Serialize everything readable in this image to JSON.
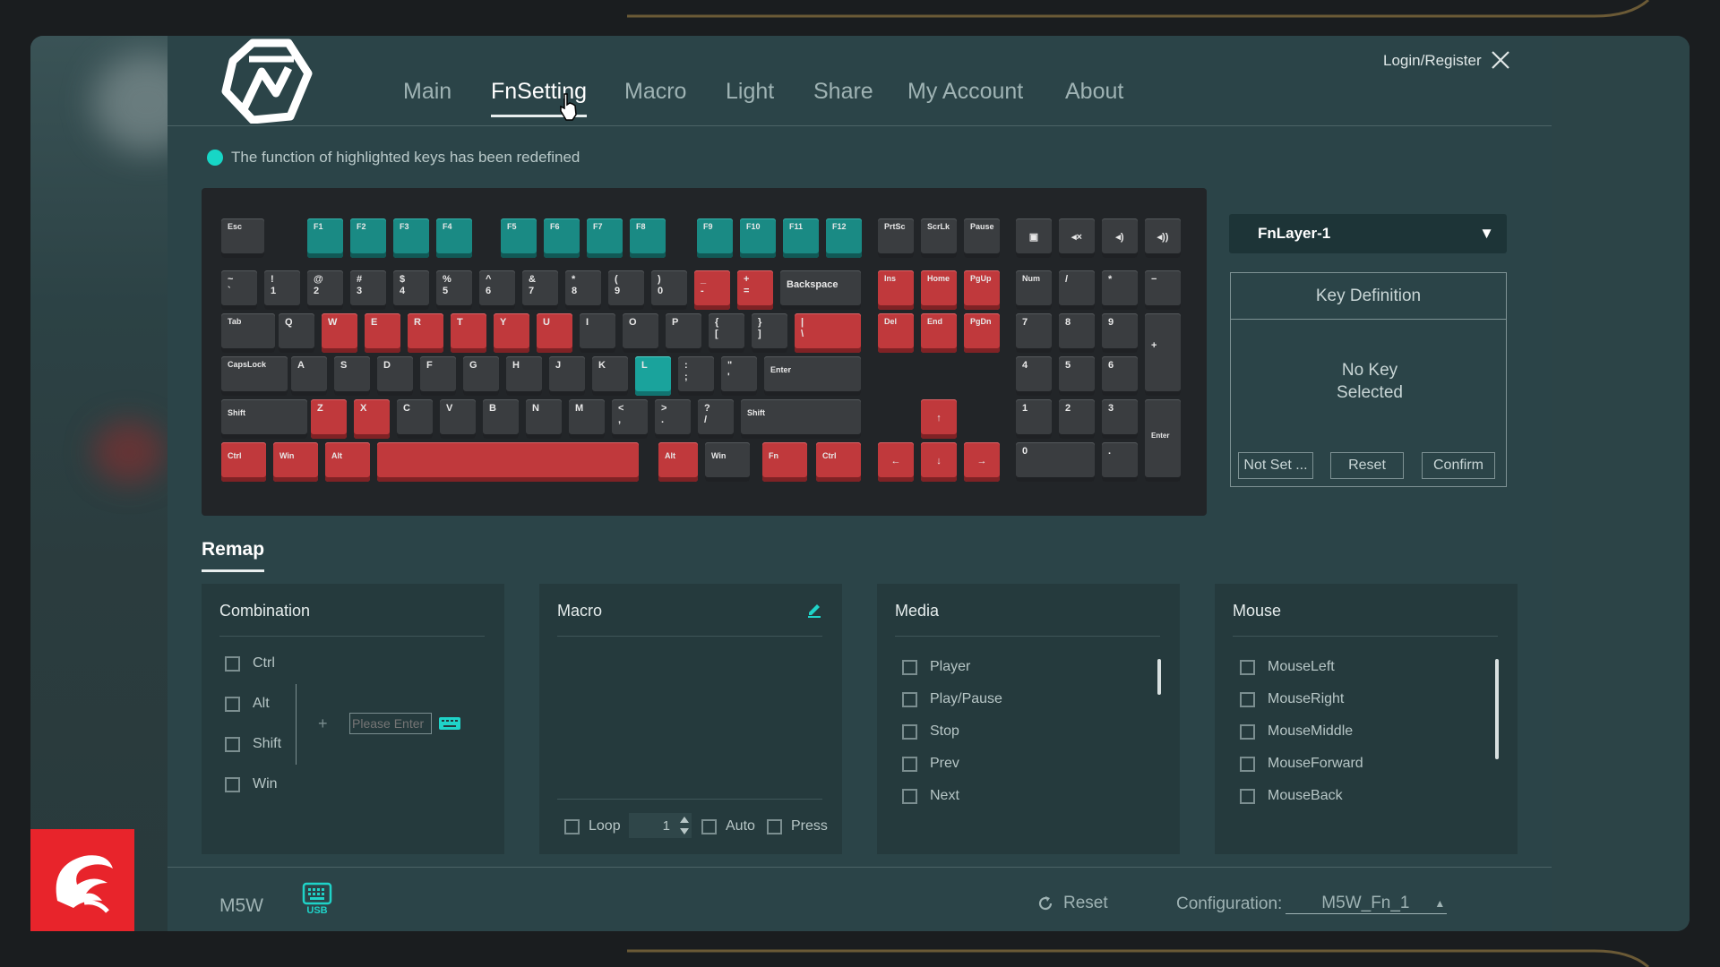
{
  "nav": {
    "items": [
      {
        "label": "Main"
      },
      {
        "label": "FnSetting"
      },
      {
        "label": "Macro"
      },
      {
        "label": "Light"
      },
      {
        "label": "Share"
      },
      {
        "label": "My Account"
      },
      {
        "label": "About"
      }
    ],
    "active": "FnSetting",
    "login": "Login/Register"
  },
  "notice": "The function of highlighted keys has been redefined",
  "keyboard": {
    "keys": {
      "esc": "Esc",
      "f1": "F1",
      "f2": "F2",
      "f3": "F3",
      "f4": "F4",
      "f5": "F5",
      "f6": "F6",
      "f7": "F7",
      "f8": "F8",
      "f9": "F9",
      "f10": "F10",
      "f11": "F11",
      "f12": "F12",
      "prtsc": "PrtSc",
      "scrlk": "ScrLk",
      "pause": "Pause",
      "tilde": "~\n`",
      "n1": "!\n1",
      "n2": "@\n2",
      "n3": "#\n3",
      "n4": "$\n4",
      "n5": "%\n5",
      "n6": "^\n6",
      "n7": "&\n7",
      "n8": "*\n8",
      "n9": "(\n9",
      "n0": ")\n0",
      "minus": "_\n-",
      "equal": "+\n=",
      "backspace": "Backspace",
      "ins": "Ins",
      "home": "Home",
      "pgup": "PgUp",
      "num": "Num",
      "kpdiv": "/",
      "kpmul": "*",
      "kpminus": "−",
      "tab": "Tab",
      "q": "Q",
      "w": "W",
      "e": "E",
      "r": "R",
      "t": "T",
      "y": "Y",
      "u": "U",
      "i": "I",
      "o": "O",
      "p": "P",
      "lbracket": "{\n[",
      "rbracket": "}\n]",
      "backslash": "|\n\\",
      "del": "Del",
      "end": "End",
      "pgdn": "PgDn",
      "kp7": "7",
      "kp8": "8",
      "kp9": "9",
      "kpplus": "+",
      "capslock": "CapsLock",
      "a": "A",
      "s": "S",
      "d": "D",
      "f": "F",
      "g": "G",
      "h": "H",
      "j": "J",
      "k": "K",
      "l": "L",
      "semicolon": ":\n;",
      "quote": "\"\n'",
      "enter": "Enter",
      "kp4": "4",
      "kp5": "5",
      "kp6": "6",
      "lshift": "Shift",
      "z": "Z",
      "x": "X",
      "c": "C",
      "v": "V",
      "b": "B",
      "n": "N",
      "m": "M",
      "comma": "<\n,",
      "period": ">\n.",
      "slash": "?\n/",
      "rshift": "Shift",
      "up": "↑",
      "kp1": "1",
      "kp2": "2",
      "kp3": "3",
      "kpenter": "Enter",
      "lctrl": "Ctrl",
      "lwin": "Win",
      "lalt": "Alt",
      "space": "",
      "ralt": "Alt",
      "rwin": "Win",
      "fn": "Fn",
      "rctrl": "Ctrl",
      "left": "←",
      "down": "↓",
      "right": "→",
      "kp0": "0",
      "kpdot": "."
    }
  },
  "fn_layer": {
    "selected": "FnLayer-1",
    "arrow": "▼"
  },
  "key_definition": {
    "title": "Key Definition",
    "empty": "No Key Selected",
    "not_set": "Not Set ...",
    "reset": "Reset",
    "confirm": "Confirm"
  },
  "remap": {
    "title": "Remap",
    "combination": {
      "title": "Combination",
      "items": [
        "Ctrl",
        "Alt",
        "Shift",
        "Win"
      ],
      "plus": "+",
      "placeholder": "Please Enter"
    },
    "macro": {
      "title": "Macro",
      "loop": "Loop",
      "count": "1",
      "auto": "Auto",
      "press": "Press"
    },
    "media": {
      "title": "Media",
      "items": [
        "Player",
        "Play/Pause",
        "Stop",
        "Prev",
        "Next"
      ]
    },
    "mouse": {
      "title": "Mouse",
      "items": [
        "MouseLeft",
        "MouseRight",
        "MouseMiddle",
        "MouseForward",
        "MouseBack"
      ]
    }
  },
  "footer": {
    "device": "M5W",
    "connection": "USB",
    "reset": "Reset",
    "config_label": "Configuration:",
    "config_value": "M5W_Fn_1"
  },
  "colors": {
    "accent_teal": "#1a8a84",
    "remapped_red": "#c0393c",
    "highlight_dot": "#17d6c6",
    "brand_red": "#e8242b"
  }
}
